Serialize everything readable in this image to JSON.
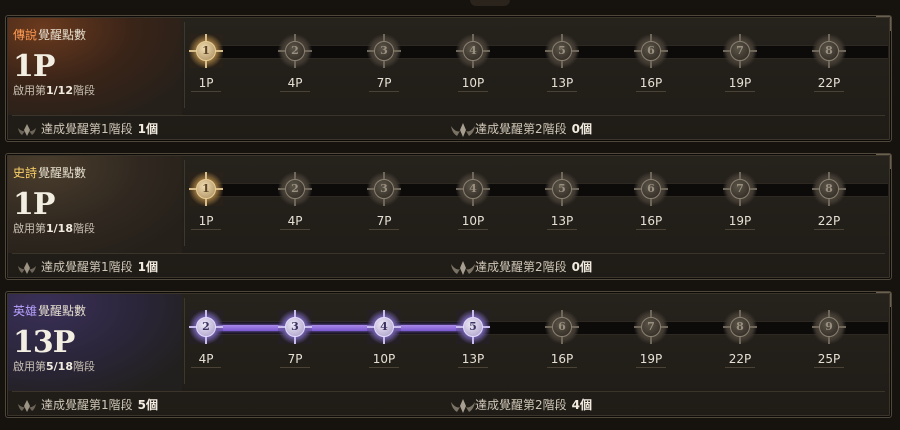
{
  "panels": [
    {
      "grade": "傳說",
      "title_suffix": "覺醒點數",
      "points": "1P",
      "stage_prefix": "啟用第",
      "stage_value": "1/12",
      "stage_suffix": "階段",
      "nodes": [
        {
          "num": "1",
          "cost": "1P"
        },
        {
          "num": "2",
          "cost": "4P"
        },
        {
          "num": "3",
          "cost": "7P"
        },
        {
          "num": "4",
          "cost": "10P"
        },
        {
          "num": "5",
          "cost": "13P"
        },
        {
          "num": "6",
          "cost": "16P"
        },
        {
          "num": "7",
          "cost": "19P"
        },
        {
          "num": "8",
          "cost": "22P"
        }
      ],
      "ach1_label": "達成覺醒第1階段",
      "ach1_count": "1個",
      "ach2_label": "達成覺醒第2階段",
      "ach2_count": "0個"
    },
    {
      "grade": "史詩",
      "title_suffix": "覺醒點數",
      "points": "1P",
      "stage_prefix": "啟用第",
      "stage_value": "1/18",
      "stage_suffix": "階段",
      "nodes": [
        {
          "num": "1",
          "cost": "1P"
        },
        {
          "num": "2",
          "cost": "4P"
        },
        {
          "num": "3",
          "cost": "7P"
        },
        {
          "num": "4",
          "cost": "10P"
        },
        {
          "num": "5",
          "cost": "13P"
        },
        {
          "num": "6",
          "cost": "16P"
        },
        {
          "num": "7",
          "cost": "19P"
        },
        {
          "num": "8",
          "cost": "22P"
        }
      ],
      "ach1_label": "達成覺醒第1階段",
      "ach1_count": "1個",
      "ach2_label": "達成覺醒第2階段",
      "ach2_count": "0個"
    },
    {
      "grade": "英雄",
      "title_suffix": "覺醒點數",
      "points": "13P",
      "stage_prefix": "啟用第",
      "stage_value": "5/18",
      "stage_suffix": "階段",
      "nodes": [
        {
          "num": "2",
          "cost": "4P"
        },
        {
          "num": "3",
          "cost": "7P"
        },
        {
          "num": "4",
          "cost": "10P"
        },
        {
          "num": "5",
          "cost": "13P"
        },
        {
          "num": "6",
          "cost": "16P"
        },
        {
          "num": "7",
          "cost": "19P"
        },
        {
          "num": "8",
          "cost": "22P"
        },
        {
          "num": "9",
          "cost": "25P"
        }
      ],
      "ach1_label": "達成覺醒第1階段",
      "ach1_count": "5個",
      "ach2_label": "達成覺醒第2階段",
      "ach2_count": "4個"
    }
  ],
  "colors": {
    "legend": "#ff9a52",
    "epic": "#ffd36a",
    "hero": "#b7a2ff",
    "hero_track": "#8e6ce0"
  }
}
